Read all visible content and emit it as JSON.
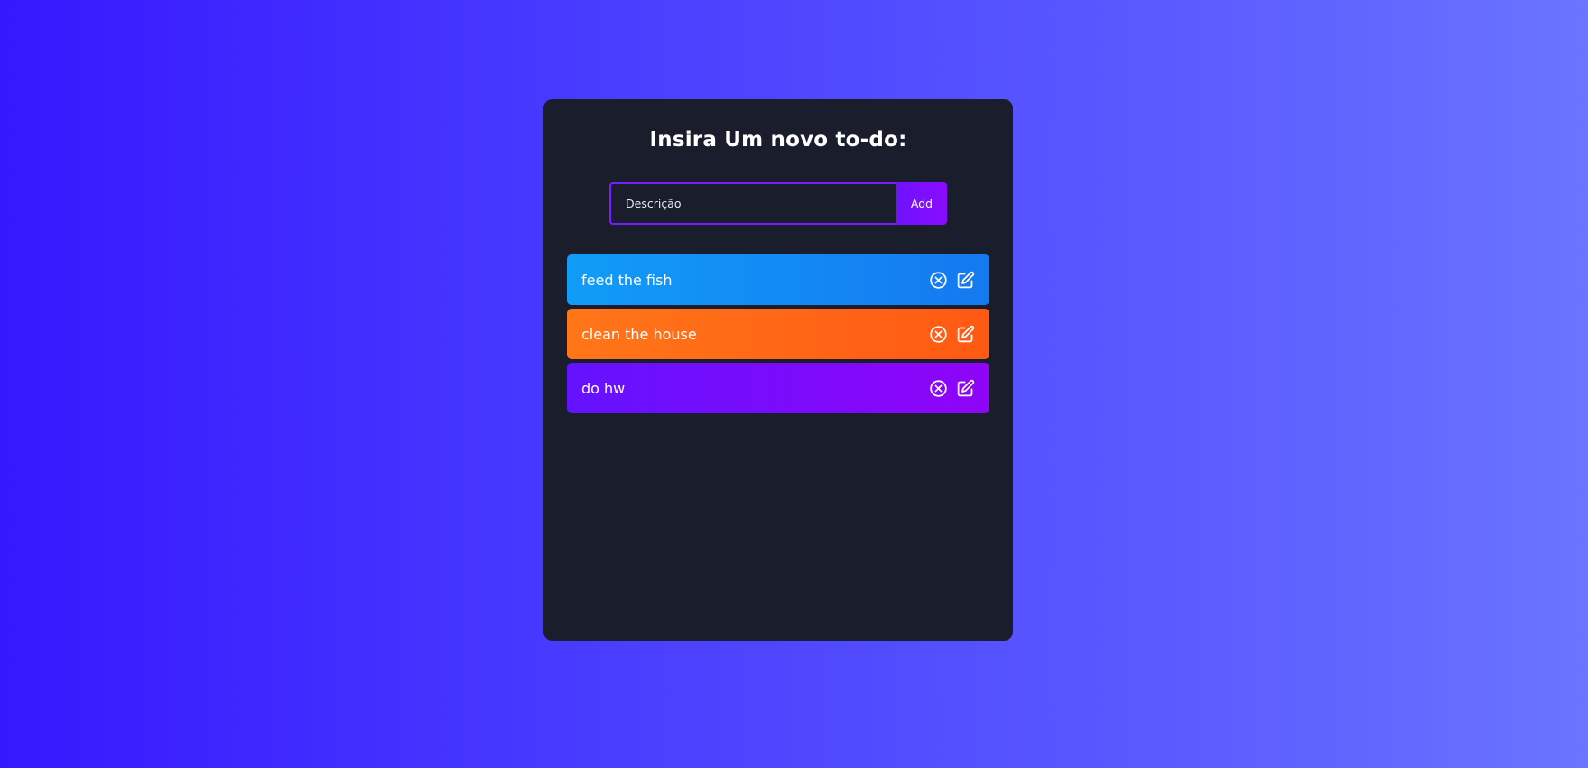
{
  "form": {
    "title": "Insira Um novo to-do:",
    "input_placeholder": "Descrição",
    "input_value": "",
    "add_label": "Add"
  },
  "todos": [
    {
      "text": "feed the fish",
      "color_start": "#119cf7",
      "color_end": "#1479f0",
      "delete_icon": "circle-x-icon",
      "edit_icon": "edit-icon"
    },
    {
      "text": "clean the house",
      "color_start": "#ff7618",
      "color_end": "#ff5914",
      "delete_icon": "circle-x-icon",
      "edit_icon": "edit-icon"
    },
    {
      "text": "do hw",
      "color_start": "#6412ff",
      "color_end": "#9004f8",
      "delete_icon": "circle-x-icon",
      "edit_icon": "edit-icon"
    }
  ],
  "colors": {
    "background_start": "#3618ff",
    "background_end": "#6a74ff",
    "card": "#1a1d2b",
    "accent": "#7a1cff"
  }
}
